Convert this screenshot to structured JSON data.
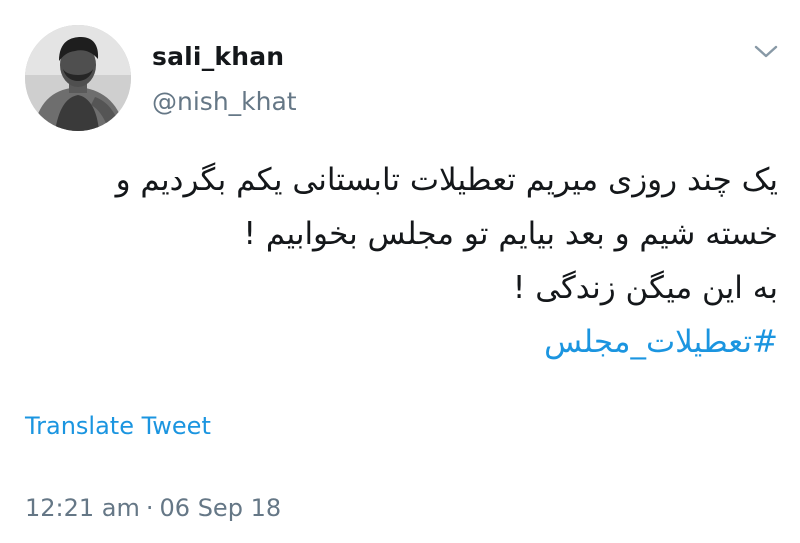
{
  "author": {
    "display_name": "sali_khan",
    "handle": "@nish_khat",
    "avatar_icon": "user-photo-avatar"
  },
  "menu": {
    "caret_icon": "chevron-down-icon"
  },
  "tweet": {
    "lines": [
      "یک چند روزی میریم تعطیلات تابستانی یکم بگردیم و",
      "خسته شیم و بعد بیایم تو مجلس بخوابیم !",
      "به این میگن زندگی !"
    ],
    "hashtag": "#تعطیلات_مجلس"
  },
  "actions": {
    "translate_label": "Translate Tweet"
  },
  "meta": {
    "time": "12:21 am",
    "separator": "·",
    "date": "06 Sep 18"
  },
  "colors": {
    "text": "#14171a",
    "secondary": "#657786",
    "link": "#1b95e0",
    "background": "#ffffff"
  }
}
